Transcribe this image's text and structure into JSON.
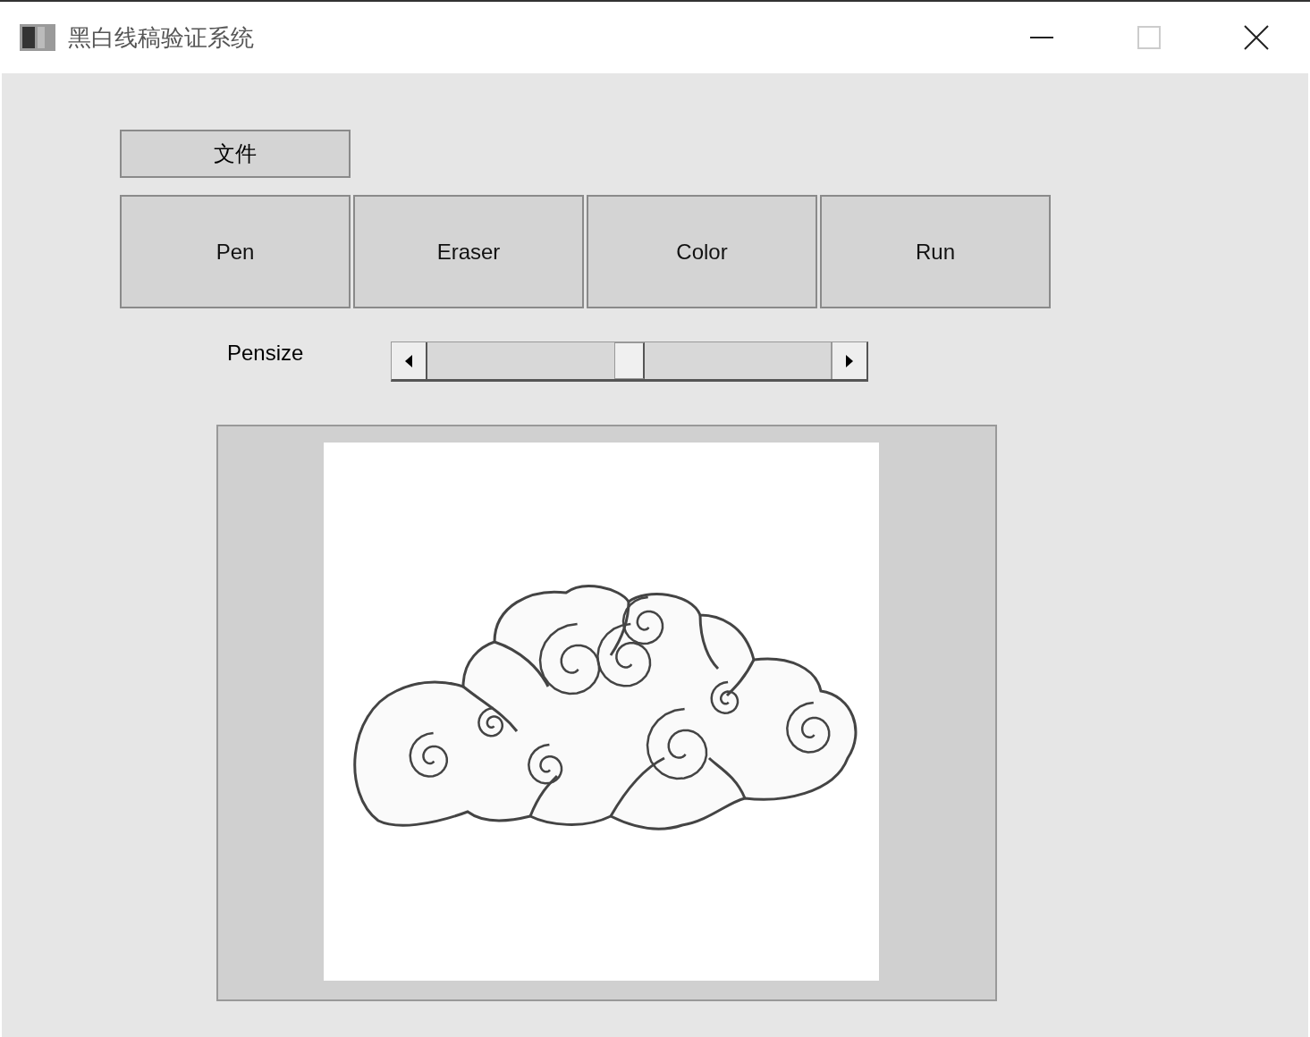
{
  "window": {
    "title": "黑白线稿验证系统",
    "controls": [
      {
        "kind": "minimize",
        "disabled": false
      },
      {
        "kind": "maximize",
        "disabled": true
      },
      {
        "kind": "close",
        "disabled": false
      }
    ]
  },
  "file_button": "文件",
  "tool_buttons": [
    "Pen",
    "Eraser",
    "Color",
    "Run"
  ],
  "pensize": {
    "label": "Pensize",
    "level": 0.5
  }
}
